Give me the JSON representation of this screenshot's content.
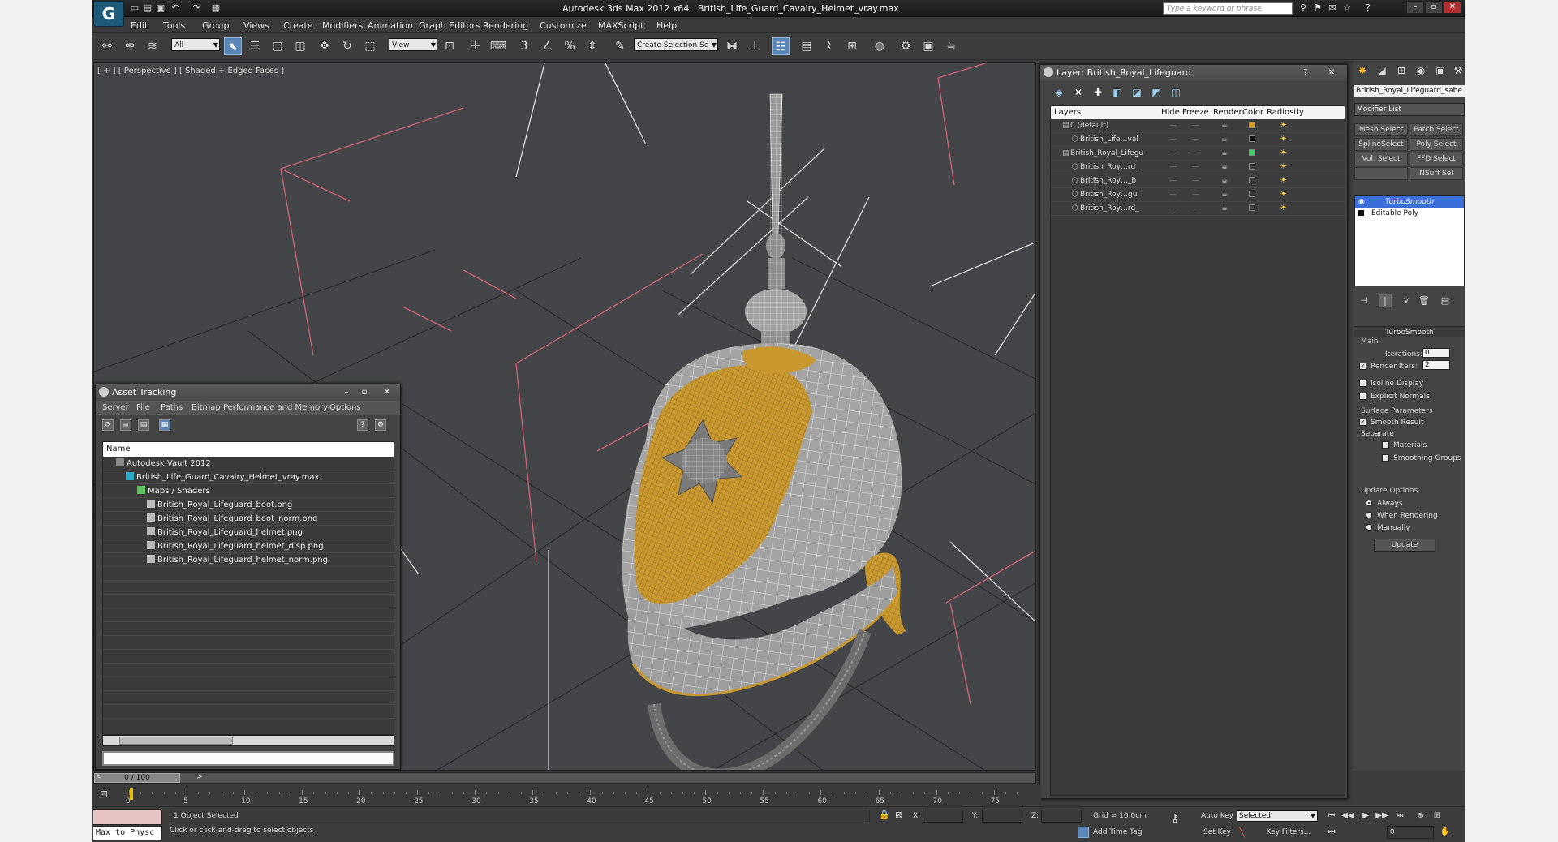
{
  "titlebar": {
    "app_title": "Autodesk 3ds Max  2012 x64",
    "file_title": "British_Life_Guard_Cavalry_Helmet_vray.max",
    "search_placeholder": "Type a keyword or phrase"
  },
  "menu": [
    "Edit",
    "Tools",
    "Group",
    "Views",
    "Create",
    "Modifiers",
    "Animation",
    "Graph Editors",
    "Rendering",
    "Customize",
    "MAXScript",
    "Help"
  ],
  "toolbar": {
    "filter_select": "All",
    "refcoord_select": "View",
    "named_selection": "Create Selection Se"
  },
  "viewport": {
    "label": "[ + ] [ Perspective ] [ Shaded + Edged Faces ]"
  },
  "asset_tracking": {
    "title": "Asset Tracking",
    "menu": [
      "Server",
      "File",
      "Paths",
      "Bitmap Performance and Memory",
      "Options"
    ],
    "column": "Name",
    "items": [
      {
        "label": "Autodesk Vault 2012",
        "level": 0
      },
      {
        "label": "British_Life_Guard_Cavalry_Helmet_vray.max",
        "level": 1
      },
      {
        "label": "Maps / Shaders",
        "level": 2
      },
      {
        "label": "British_Royal_Lifeguard_boot.png",
        "level": 3
      },
      {
        "label": "British_Royal_Lifeguard_boot_norm.png",
        "level": 3
      },
      {
        "label": "British_Royal_Lifeguard_helmet.png",
        "level": 3
      },
      {
        "label": "British_Royal_Lifeguard_helmet_disp.png",
        "level": 3
      },
      {
        "label": "British_Royal_Lifeguard_helmet_norm.png",
        "level": 3
      }
    ]
  },
  "layer_manager": {
    "title": "Layer: British_Royal_Lifeguard",
    "columns": [
      "Layers",
      "Hide",
      "Freeze",
      "Render",
      "Color",
      "Radiosity"
    ],
    "rows": [
      {
        "name": "0 (default)",
        "level": 0,
        "color": "#d8a020"
      },
      {
        "name": "British_Life…val",
        "level": 1,
        "color": "#111111"
      },
      {
        "name": "British_Royal_Lifegu",
        "level": 0,
        "color": "#3ed060"
      },
      {
        "name": "British_Roy…rd_",
        "level": 1,
        "color": "#3a3a3a"
      },
      {
        "name": "British_Roy…_b",
        "level": 1,
        "color": "#3a3a3a"
      },
      {
        "name": "British_Roy…gu",
        "level": 1,
        "color": "#3a3a3a"
      },
      {
        "name": "British_Roy…rd_",
        "level": 1,
        "color": "#3a3a3a"
      }
    ]
  },
  "command_panel": {
    "object_name": "British_Royal_Lifeguard_sabe",
    "modifier_list": "Modifier List",
    "mod_buttons": [
      "Mesh Select",
      "Patch Select",
      "SplineSelect",
      "Poly Select",
      "Vol. Select",
      "FFD Select",
      "",
      "NSurf Sel"
    ],
    "stack": [
      "TurboSmooth",
      "Editable Poly"
    ],
    "turbosmooth": {
      "rollout_title": "TurboSmooth",
      "main_group": "Main",
      "iterations_label": "Iterations:",
      "iterations_value": "0",
      "render_iters_label": "Render Iters:",
      "render_iters_value": "2",
      "isoline_label": "Isoline Display",
      "explicit_normals_label": "Explicit Normals",
      "surface_group": "Surface Parameters",
      "smooth_result_label": "Smooth Result",
      "separate_label": "Separate",
      "materials_label": "Materials",
      "smoothing_groups_label": "Smoothing Groups",
      "update_group": "Update Options",
      "always_label": "Always",
      "when_rendering_label": "When Rendering",
      "manually_label": "Manually",
      "update_button": "Update"
    }
  },
  "timeline": {
    "slider_label": "0 / 100",
    "ticks": [
      "0",
      "5",
      "10",
      "15",
      "20",
      "25",
      "30",
      "35",
      "40",
      "45",
      "50",
      "55",
      "60",
      "65",
      "70",
      "75"
    ]
  },
  "statusbar": {
    "maxscript_text": "Max to Physc",
    "selection_count": "1 Object Selected",
    "prompt": "Click or click-and-drag to select objects",
    "x_label": "X:",
    "y_label": "Y:",
    "z_label": "Z:",
    "grid": "Grid = 10,0cm",
    "add_time_tag": "Add Time Tag",
    "auto_key": "Auto Key",
    "set_key": "Set Key",
    "key_filters": "Key Filters...",
    "selection_set": "Selected",
    "frame_value": "0"
  }
}
